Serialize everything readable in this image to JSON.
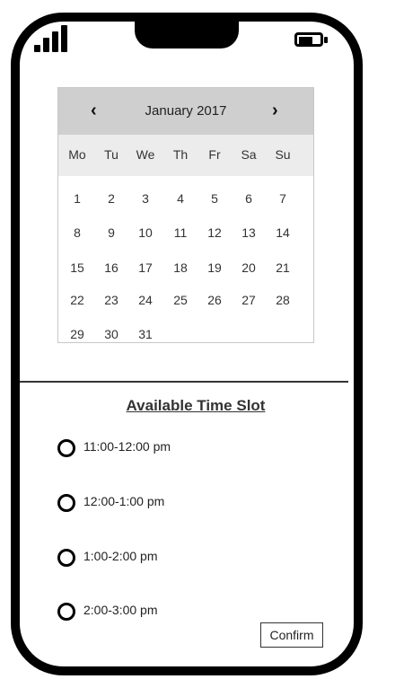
{
  "calendar": {
    "month_label": "January 2017",
    "prev_symbol": "‹",
    "next_symbol": "›",
    "weekdays": [
      "Mo",
      "Tu",
      "We",
      "Th",
      "Fr",
      "Sa",
      "Su"
    ],
    "days": [
      "1",
      "2",
      "3",
      "4",
      "5",
      "6",
      "7",
      "8",
      "9",
      "10",
      "11",
      "12",
      "13",
      "14",
      "15",
      "16",
      "17",
      "18",
      "19",
      "20",
      "21",
      "22",
      "23",
      "24",
      "25",
      "26",
      "27",
      "28",
      "29",
      "30",
      "31"
    ]
  },
  "slots": {
    "title": "Available Time Slot",
    "items": [
      "11:00-12:00 pm",
      "12:00-1:00 pm",
      "1:00-2:00 pm",
      "2:00-3:00 pm"
    ]
  },
  "confirm_label": "Confirm",
  "icons": {
    "signal": "signal-bars-icon",
    "battery": "battery-icon"
  }
}
